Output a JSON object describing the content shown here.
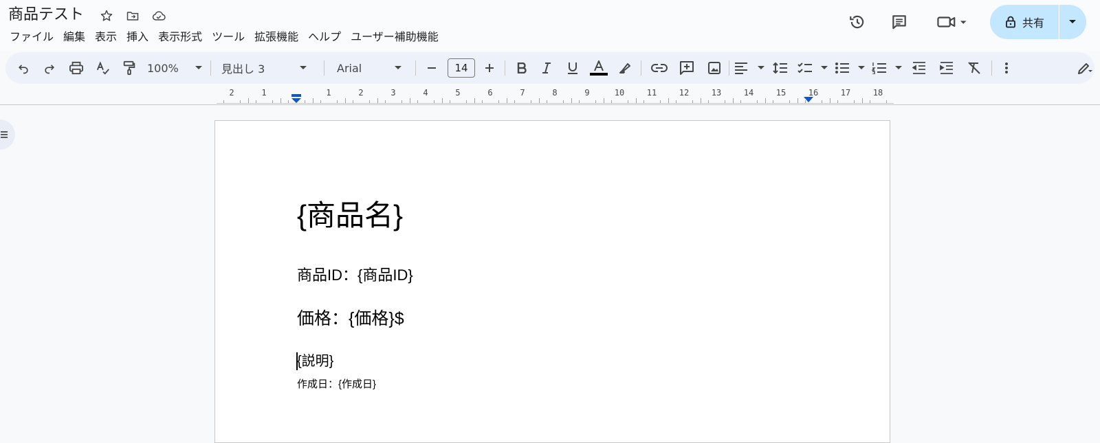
{
  "app": {
    "doc_title": "商品テスト"
  },
  "menu": [
    "ファイル",
    "編集",
    "表示",
    "挿入",
    "表示形式",
    "ツール",
    "拡張機能",
    "ヘルプ",
    "ユーザー補助機能"
  ],
  "share": {
    "label": "共有"
  },
  "toolbar": {
    "zoom": "100%",
    "style": "見出し 3",
    "font": "Arial",
    "font_size": "14"
  },
  "ruler": {
    "labels": [
      "2",
      "1",
      "1",
      "2",
      "3",
      "4",
      "5",
      "6",
      "7",
      "8",
      "9",
      "10",
      "11",
      "12",
      "13",
      "14",
      "15",
      "16",
      "17",
      "18"
    ]
  },
  "document": {
    "heading": "{商品名}",
    "line_id": "商品ID：{商品ID}",
    "line_price": "価格：{価格}$",
    "line_desc": "{説明}",
    "line_date": "作成日：{作成日}"
  },
  "colors": {
    "accent": "#0b57d0",
    "share_bg": "#c2e7ff",
    "toolbar_bg": "#edf2fa"
  }
}
